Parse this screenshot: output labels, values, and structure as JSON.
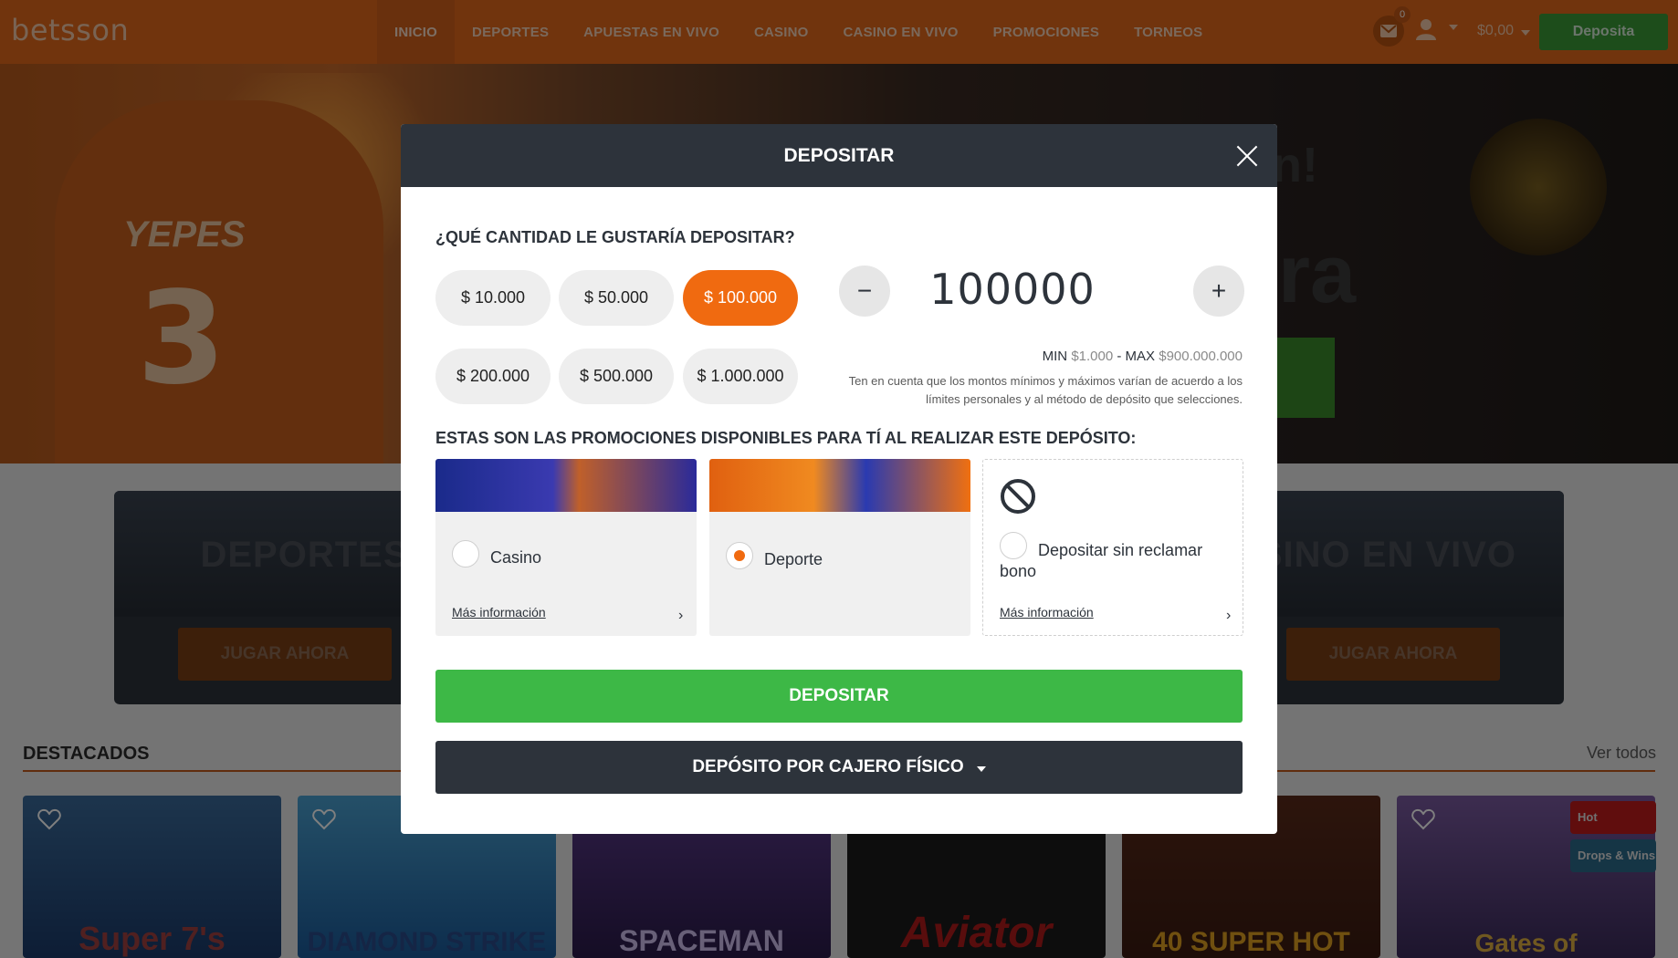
{
  "header": {
    "logo": "betsson",
    "nav": [
      "INICIO",
      "DEPORTES",
      "APUESTAS EN VIVO",
      "CASINO",
      "CASINO EN VIVO",
      "PROMOCIONES",
      "TORNEOS"
    ],
    "mail_count": "0",
    "balance": "$0,00",
    "deposit_label": "Deposita",
    "accent": "#e3681b"
  },
  "hero": {
    "name_text": "YEPES",
    "number_text": "3",
    "side_text_1": "on!",
    "side_text_2": "ra"
  },
  "categories": [
    {
      "title": "DEPORTES",
      "button": "JUGAR AHORA"
    },
    {
      "title": "ASINO EN VIVO",
      "button": "JUGAR AHORA"
    }
  ],
  "featured": {
    "title": "DESTACADOS",
    "see_all": "Ver todos",
    "games": [
      "Super 7's",
      "DIAMOND STRIKE",
      "SPACEMAN",
      "Aviator",
      "40 SUPER HOT",
      "Gates of"
    ],
    "tags": [
      "Hot",
      "Drops & Wins"
    ]
  },
  "modal": {
    "title": "DEPOSITAR",
    "question": "¿QUÉ CANTIDAD LE GUSTARÍA DEPOSITAR?",
    "amounts": [
      "$ 10.000",
      "$ 50.000",
      "$ 100.000",
      "$ 200.000",
      "$ 500.000",
      "$ 1.000.000"
    ],
    "selected_amount": "$ 100.000",
    "amount_value": "100000",
    "minus_symbol": "−",
    "plus_symbol": "+",
    "min_label": "MIN",
    "min_value": "$1.000",
    "separator": "-",
    "max_label": "MAX",
    "max_value": "$900.000.000",
    "limits_note": "Ten en cuenta que los montos mínimos y máximos varían de acuerdo a los límites personales y al método de depósito que selecciones.",
    "promo_title": "ESTAS SON LAS PROMOCIONES DISPONIBLES PARA TÍ AL REALIZAR ESTE DEPÓSITO:",
    "promos": [
      {
        "label": "Casino",
        "more": "Más información",
        "checked": false
      },
      {
        "label": "Deporte",
        "checked": true
      },
      {
        "label": "Depositar sin reclamar bono",
        "more": "Más información",
        "checked": false
      }
    ],
    "deposit_button": "DEPOSITAR",
    "cashier_button": "DEPÓSITO POR CAJERO FÍSICO",
    "brand_orange": "#f06a10",
    "brand_green": "#3db846"
  }
}
